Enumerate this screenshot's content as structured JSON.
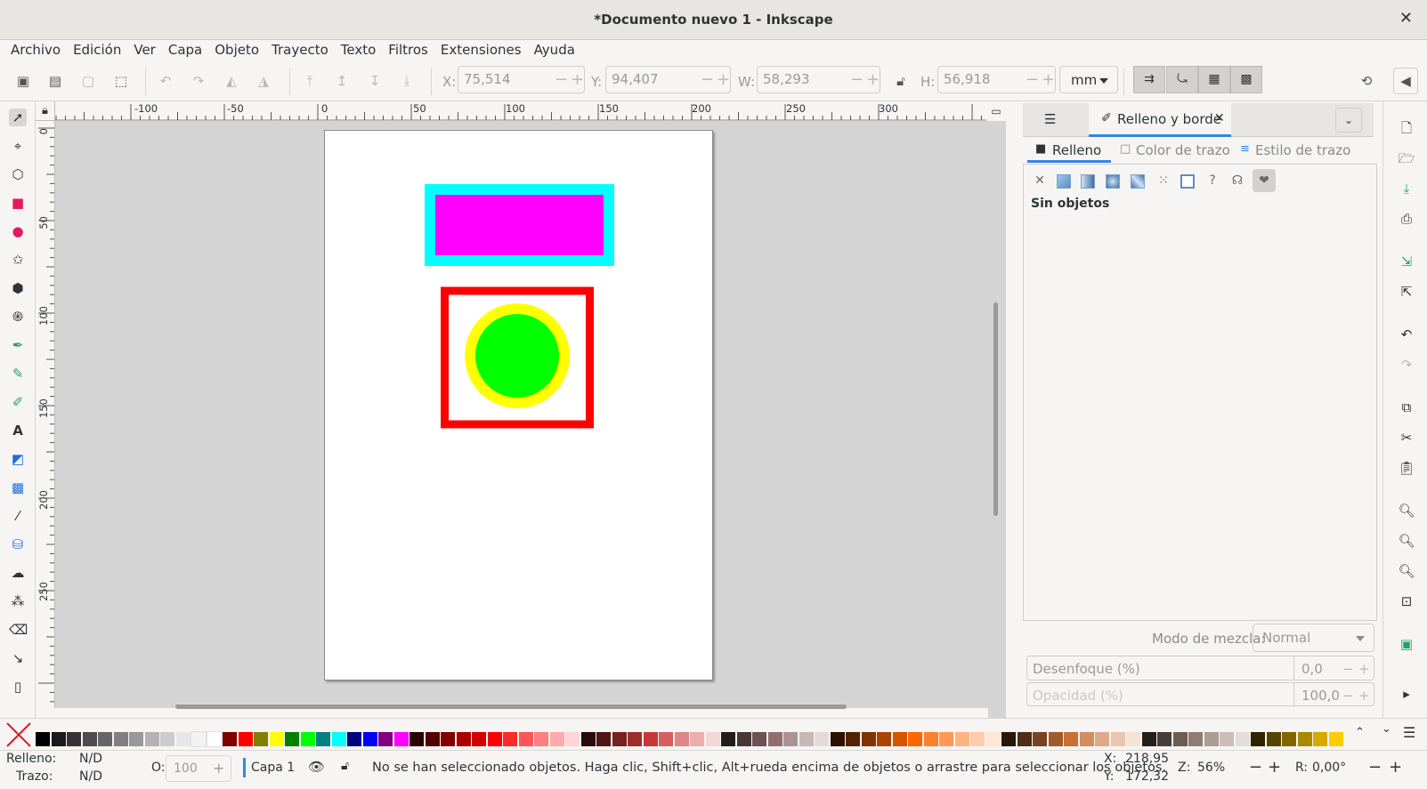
{
  "window": {
    "title": "*Documento nuevo 1 - Inkscape",
    "close_glyph": "✕"
  },
  "menu": [
    "Archivo",
    "Edición",
    "Ver",
    "Capa",
    "Objeto",
    "Trayecto",
    "Texto",
    "Filtros",
    "Extensiones",
    "Ayuda"
  ],
  "toolbar": {
    "x_label": "X:",
    "x_value": "75,514",
    "y_label": "Y:",
    "y_value": "94,407",
    "w_label": "W:",
    "w_value": "58,293",
    "h_label": "H:",
    "h_value": "56,918",
    "unit": "mm"
  },
  "ruler": {
    "h_labels": [
      "-100",
      "-50",
      "0",
      "50",
      "100",
      "150",
      "200",
      "250",
      "300"
    ],
    "v_labels": [
      "0",
      "50",
      "100",
      "150",
      "200",
      "250"
    ]
  },
  "canvas": {
    "shapes": [
      {
        "name": "magenta-rect",
        "fill": "#ff00ff",
        "stroke": "#00ffff"
      },
      {
        "name": "red-frame",
        "fill": "none",
        "stroke": "#ff0000"
      },
      {
        "name": "green-circle",
        "fill": "#00ff00",
        "stroke": "#ffff00"
      }
    ]
  },
  "dock": {
    "tab_label": "Relleno y borde",
    "tab_close": "✕",
    "subtabs": {
      "fill": "Relleno",
      "stroke_paint": "Color de trazo",
      "stroke_style": "Estilo de trazo"
    },
    "no_objects": "Sin objetos",
    "blend_label": "Modo de mezcla:",
    "blend_value": "Normal",
    "blur_label": "Desenfoque (%)",
    "blur_value": "0,0",
    "opacity_label": "Opacidad (%)",
    "opacity_value": "100,0"
  },
  "palette": {
    "colors": [
      "#000000",
      "#1a1a1a",
      "#333333",
      "#4d4d4d",
      "#666666",
      "#808080",
      "#999999",
      "#b3b3b3",
      "#cccccc",
      "#e6e6e6",
      "#f2f2f2",
      "#ffffff",
      "#800000",
      "#ff0000",
      "#808000",
      "#ffff00",
      "#008000",
      "#00ff00",
      "#008080",
      "#00ffff",
      "#000080",
      "#0000ff",
      "#800080",
      "#ff00ff",
      "#2b0000",
      "#550000",
      "#800000",
      "#aa0000",
      "#d40000",
      "#ff0000",
      "#ff2a2a",
      "#ff5555",
      "#ff8080",
      "#ffaaaa",
      "#ffd5d5",
      "#280b0b",
      "#501616",
      "#782121",
      "#a02c2c",
      "#c83737",
      "#d35f5f",
      "#de8787",
      "#e9afaf",
      "#f4d7d7",
      "#241c1c",
      "#483737",
      "#6c5353",
      "#916f6f",
      "#ac9393",
      "#c8b7b7",
      "#e3dbdb",
      "#2b1100",
      "#552200",
      "#803300",
      "#aa4400",
      "#d45500",
      "#ff6600",
      "#ff7f2a",
      "#ff9955",
      "#ffb380",
      "#ffccaa",
      "#ffe6d5",
      "#28170b",
      "#502d16",
      "#784421",
      "#a05a2c",
      "#c87137",
      "#d38d5f",
      "#deaa87",
      "#e9c6af",
      "#f4e3d7",
      "#241f1c",
      "#483e37",
      "#6c5d53",
      "#917c6f",
      "#ac9d93",
      "#c8beb7",
      "#e3dedb",
      "#2b2200",
      "#554400",
      "#806600",
      "#aa8800",
      "#d4aa00",
      "#ffcc00"
    ]
  },
  "status": {
    "fill_label": "Relleno:",
    "fill_value": "N/D",
    "stroke_label": "Trazo:",
    "stroke_value": "N/D",
    "opacity_label": "O:",
    "opacity_value": "100",
    "layer": "Capa 1",
    "message": "No se han seleccionado objetos. Haga clic, Shift+clic, Alt+rueda encima de objetos o arrastre para seleccionar los objetos.",
    "cursor_x_label": "X:",
    "cursor_x": "218,95",
    "cursor_y_label": "Y:",
    "cursor_y": "172,32",
    "zoom_label": "Z:",
    "zoom": "56%",
    "rotate_label": "R:",
    "rotate": "0,00°"
  }
}
